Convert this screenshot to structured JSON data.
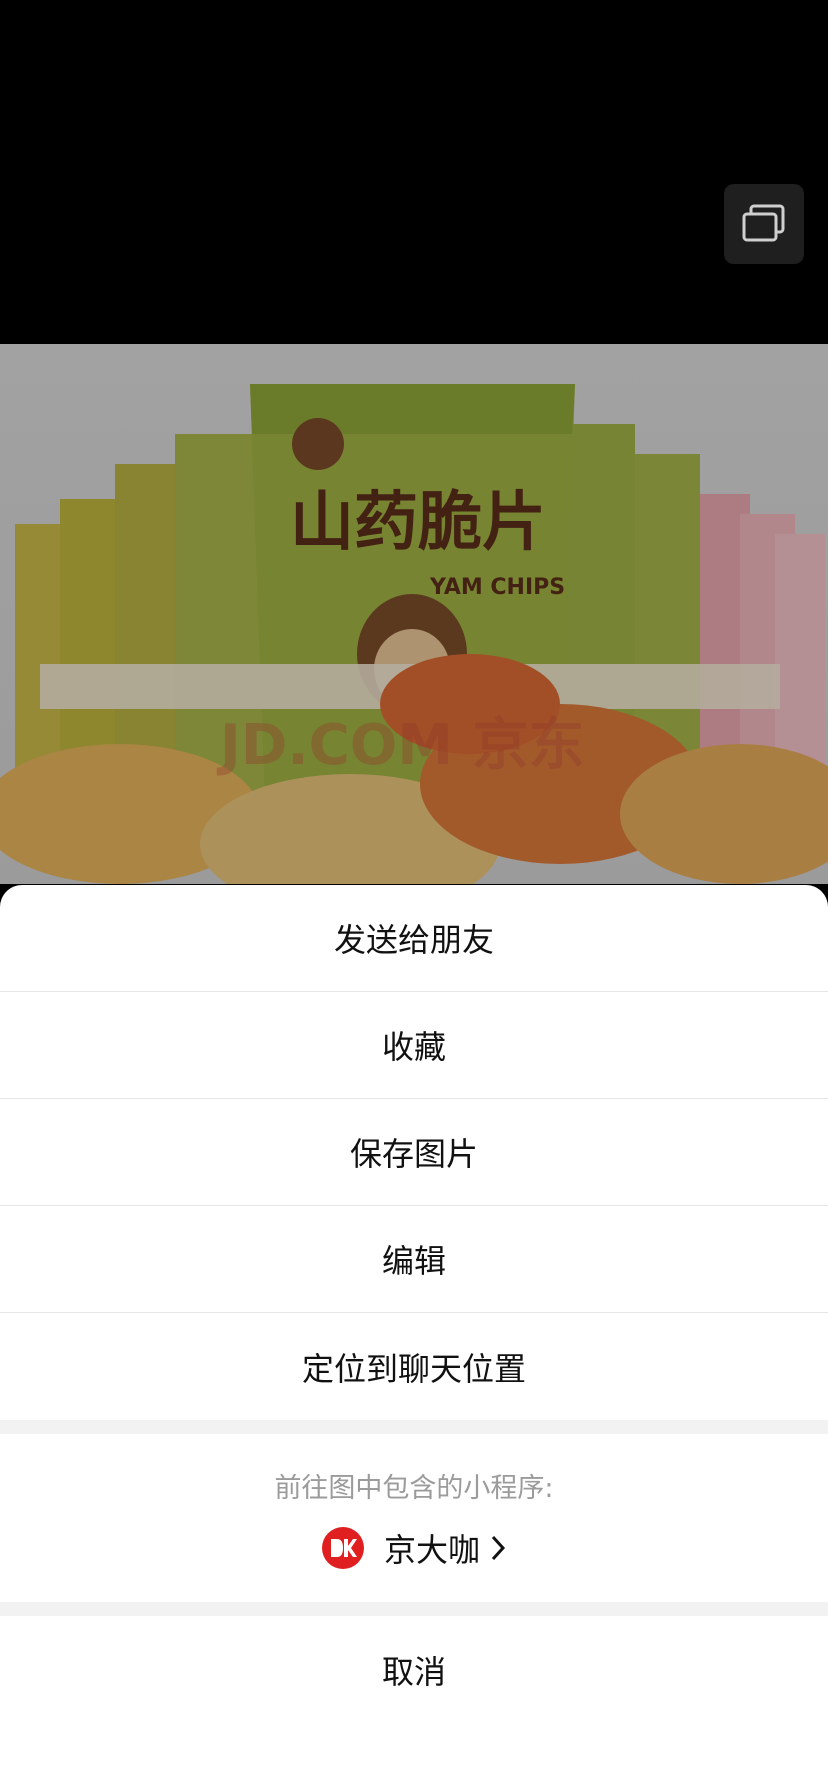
{
  "sheet": {
    "actions": [
      "发送给朋友",
      "收藏",
      "保存图片",
      "编辑",
      "定位到聊天位置"
    ],
    "mini_program": {
      "hint": "前往图中包含的小程序:",
      "name": "京大咖"
    },
    "cancel": "取消"
  },
  "photo": {
    "title": "山药脆片",
    "subtitle": "YAM CHIPS",
    "watermark": "JD.COM 京东"
  },
  "icons": {
    "corner": "multi-window-icon",
    "mini_logo": "jd-logo-icon",
    "arrow": "chevron-right-icon"
  }
}
